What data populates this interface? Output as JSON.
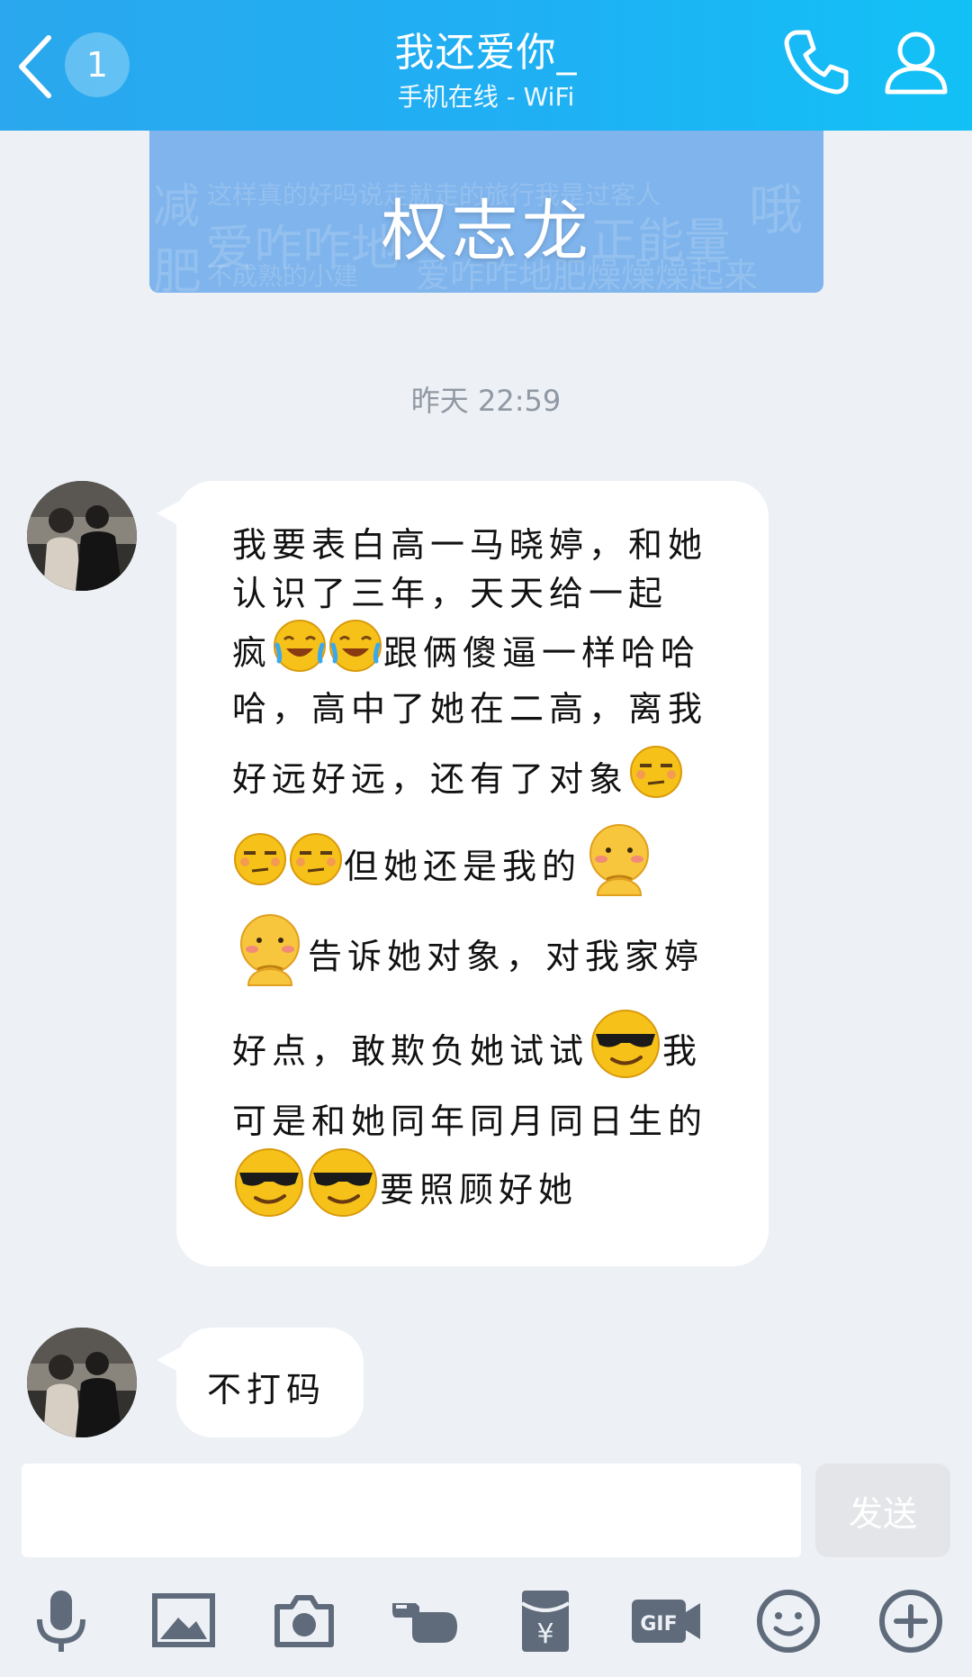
{
  "header": {
    "back_count": "1",
    "title": "我还爱你_",
    "subtitle": "手机在线 - WiFi"
  },
  "banner": {
    "name": "权志龙",
    "bg_phrases": [
      "减",
      "这样真的好吗说走就走的旅行我是过客人",
      "哦",
      "爱咋咋地",
      "正能量",
      "肥",
      "不成熟的小建",
      "爱咋咋地肥燥燥燥起来"
    ]
  },
  "timestamp": "昨天 22:59",
  "messages": [
    {
      "lines": [
        "我要表白高一马晓婷，和她",
        "认识了三年，天天给一起",
        [
          "疯",
          "[joy-emoji]",
          "[joy-emoji]",
          "跟俩傻逼一样哈哈"
        ],
        "哈，高中了她在二高，离我",
        [
          "好远好远，还有了对象",
          "[unamused-emoji]"
        ],
        [
          "[unamused-emoji]",
          "[unamused-emoji]",
          "但她还是我的",
          "[shy-emoji]"
        ],
        [
          "[shy-emoji]",
          "告诉她对象，对我家婷"
        ],
        [
          "好点，敢欺负她试试",
          "[cool-emoji]",
          "我"
        ],
        "可是和她同年同月同日生的",
        [
          "[cool-emoji]",
          "[cool-emoji]",
          "要照顾好她"
        ]
      ]
    },
    {
      "lines": [
        "不打码"
      ]
    }
  ],
  "input": {
    "placeholder": "",
    "value": ""
  },
  "send_label": "发送",
  "toolbar": [
    "mic-icon",
    "image-icon",
    "camera-icon",
    "poke-icon",
    "red-packet-icon",
    "gif-icon",
    "emoji-icon",
    "plus-icon"
  ],
  "colors": {
    "header_start": "#2aa7ee",
    "header_end": "#12c1f6",
    "background": "#edf1f6",
    "banner": "#7fb4ec"
  }
}
